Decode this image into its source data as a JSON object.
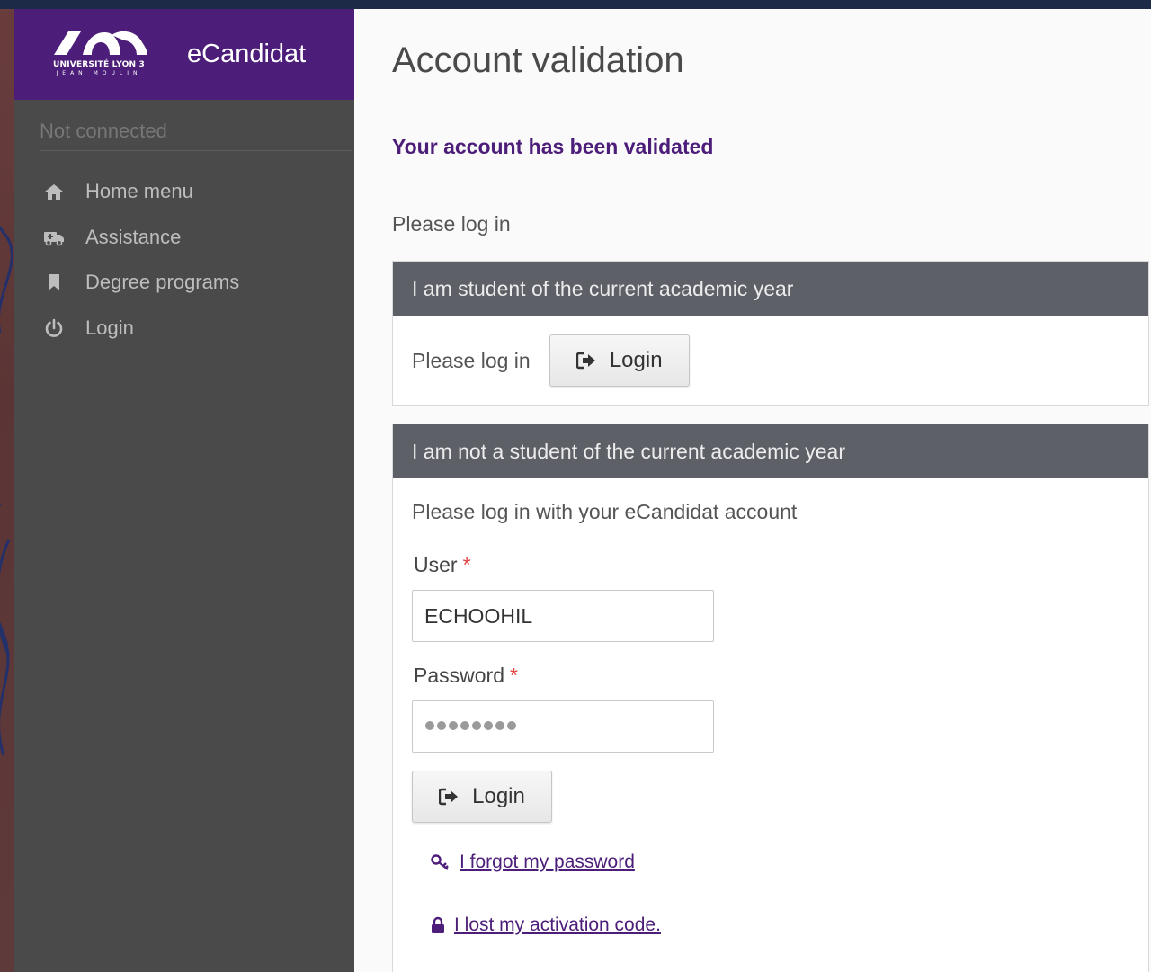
{
  "brand": {
    "university_line1": "UNIVERSITÉ LYON 3",
    "university_line2": "JEAN MOULIN",
    "app_name": "eCandidat"
  },
  "sidebar": {
    "status": "Not connected",
    "items": [
      {
        "label": "Home menu",
        "icon": "home-icon"
      },
      {
        "label": "Assistance",
        "icon": "ambulance-icon"
      },
      {
        "label": "Degree programs",
        "icon": "bookmark-icon"
      },
      {
        "label": "Login",
        "icon": "power-icon"
      }
    ]
  },
  "main": {
    "title": "Account validation",
    "validated_message": "Your account has been validated",
    "please_log_in": "Please log in",
    "student_panel": {
      "heading": "I am student of the current academic year",
      "prompt": "Please log in",
      "login_button": "Login"
    },
    "non_student_panel": {
      "heading": "I am not a student of the current academic year",
      "intro": "Please log in with your eCandidat account",
      "user_label": "User",
      "user_value": "ECHOOHIL",
      "password_label": "Password",
      "required_mark": "*",
      "login_button": "Login",
      "forgot_password": "I forgot my password",
      "lost_activation": "I lost my activation code."
    }
  },
  "colors": {
    "brand_purple": "#4c1e7a",
    "sidebar_bg": "#4a4a4a",
    "panel_header": "#5e6068",
    "required": "#e04040"
  }
}
